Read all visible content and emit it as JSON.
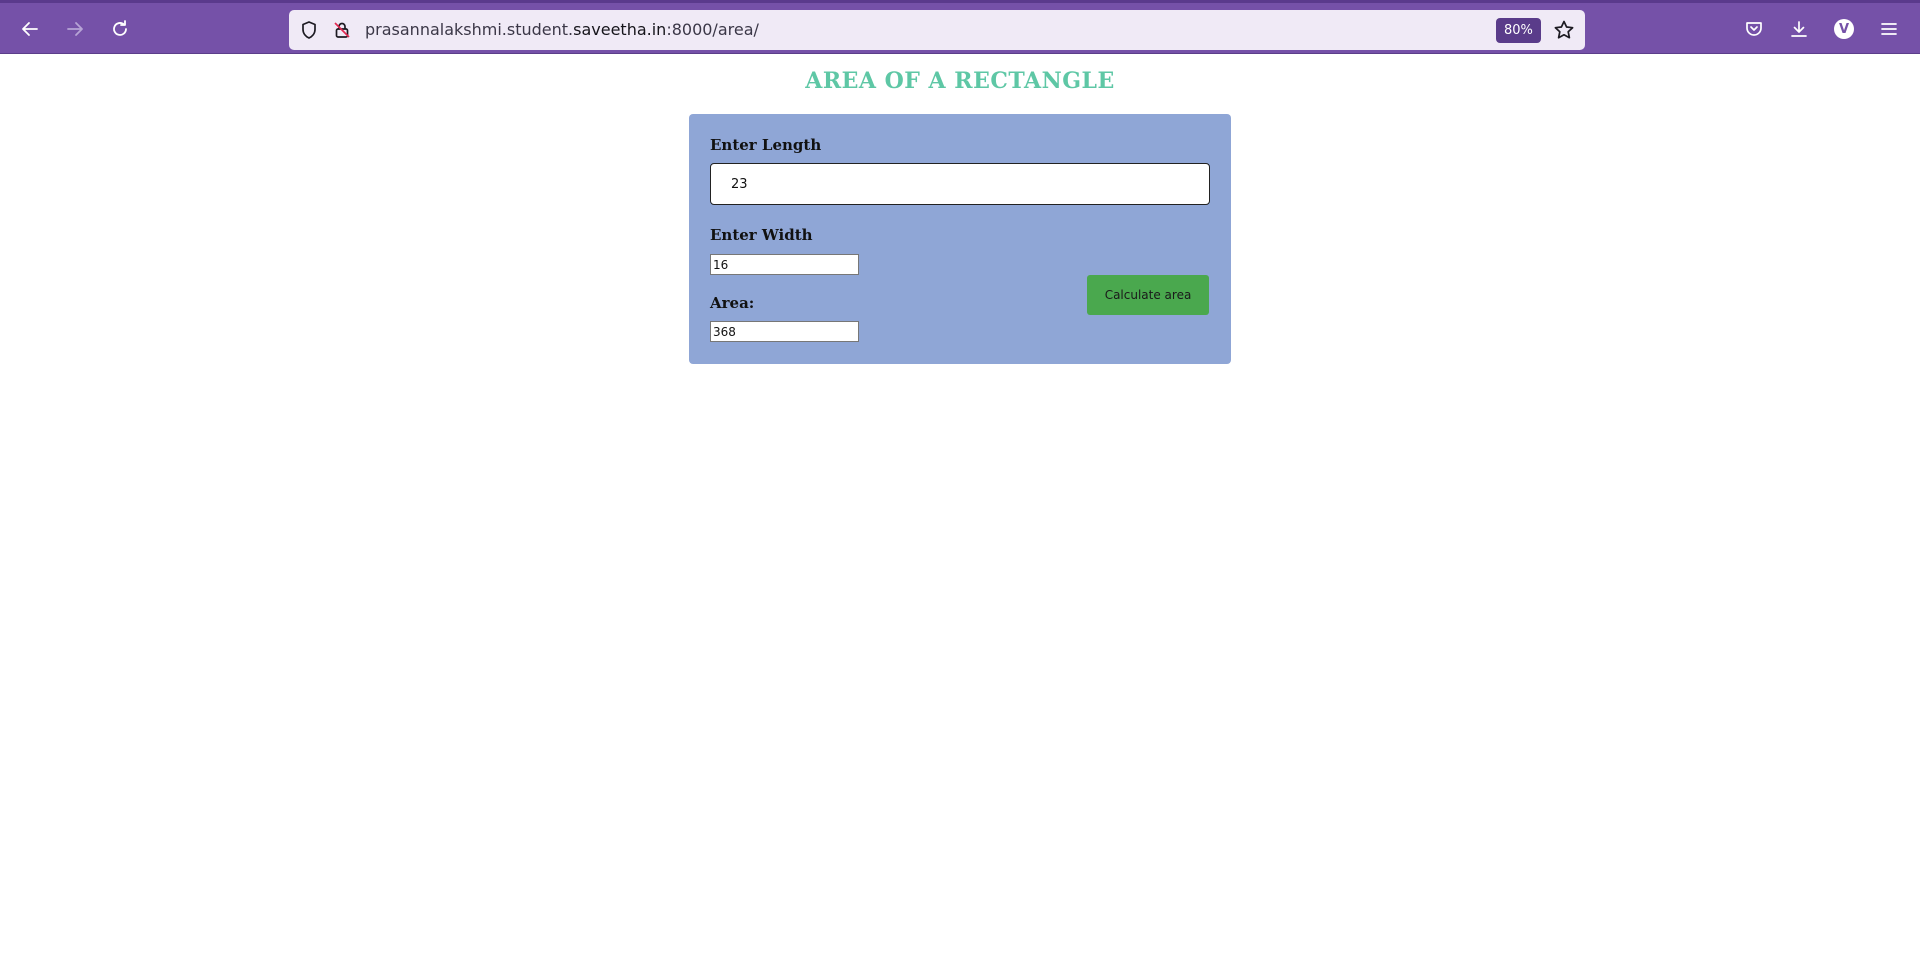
{
  "browser": {
    "url_prefix": "prasannalakshmi.student.",
    "url_host": "saveetha.in",
    "url_suffix": ":8000/area/",
    "zoom": "80%",
    "profile_initial": "V"
  },
  "page": {
    "title": "AREA OF A RECTANGLE",
    "length_label": "Enter Length",
    "length_value": "23",
    "width_label": "Enter Width",
    "width_value": "16",
    "area_label": "Area:",
    "area_value": "368",
    "button_label": "Calculate area"
  },
  "colors": {
    "toolbar": "#7551a8",
    "title": "#5ec7a5",
    "card": "#8fa6d6",
    "button": "#4aa84e"
  }
}
